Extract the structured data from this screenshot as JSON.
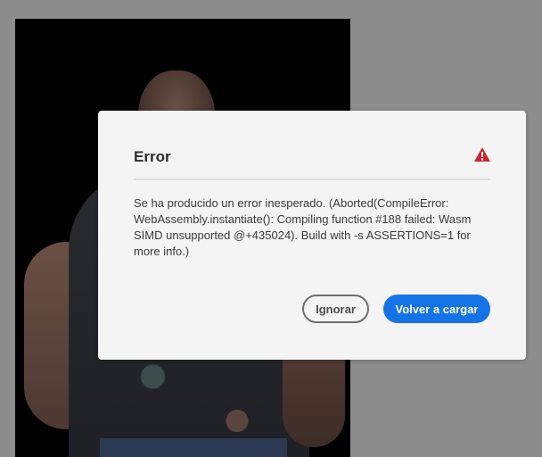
{
  "dialog": {
    "title": "Error",
    "icon": "alert-triangle-icon",
    "icon_color": "#c9252d",
    "message": "Se ha producido un error inesperado. (Aborted(CompileError: WebAssembly.instantiate(): Compiling function #188 failed: Wasm SIMD unsupported @+435024). Build with -s ASSERTIONS=1 for more info.)",
    "buttons": {
      "ignore_label": "Ignorar",
      "reload_label": "Volver a cargar"
    },
    "accent_color": "#1473e6"
  },
  "background": {
    "overlay_color": "#8d8d8d"
  }
}
